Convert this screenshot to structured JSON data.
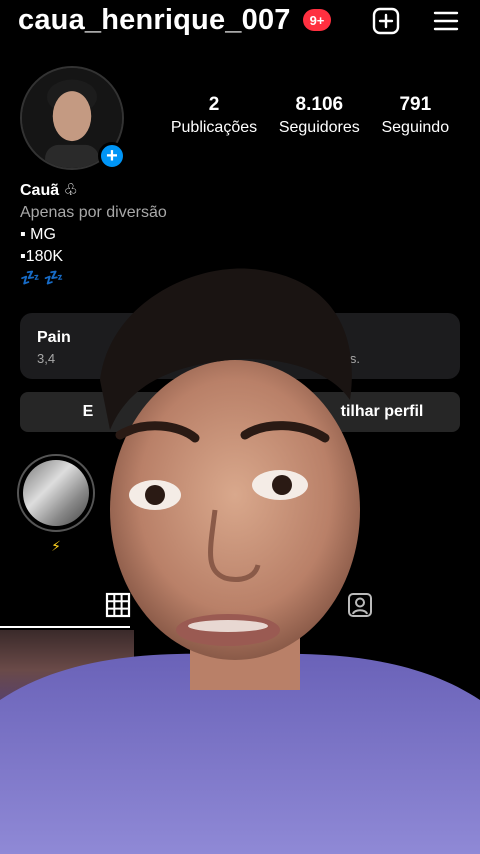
{
  "header": {
    "username": "caua_henrique_007",
    "notifications_badge": "9+",
    "add_icon": "plus-square-icon",
    "menu_icon": "hamburger-menu-icon"
  },
  "profile": {
    "avatar_add_symbol": "+",
    "stats": [
      {
        "value": "2",
        "label": "Publicações"
      },
      {
        "value": "8.106",
        "label": "Seguidores"
      },
      {
        "value": "791",
        "label": "Seguindo"
      }
    ],
    "name": "Cauã ♧",
    "bio_category": "Apenas por diversão",
    "bio_lines": [
      "▪ MG",
      "▪180K"
    ],
    "bio_emoji": "💤💤"
  },
  "dashboard": {
    "title": "Pain",
    "subtitle": "3,4",
    "subtitle_end": "as."
  },
  "buttons": {
    "edit_partial": "E",
    "share_partial": "tilhar perfil"
  },
  "highlights": [
    {
      "label": "⚡"
    }
  ],
  "tabs": {
    "grid_icon": "grid-icon",
    "tagged_icon": "tagged-person-icon"
  },
  "colors": {
    "badge": "#ff3040",
    "plus_button": "#0095f6",
    "card_bg": "#1c1c1e",
    "button_bg": "#262626"
  }
}
